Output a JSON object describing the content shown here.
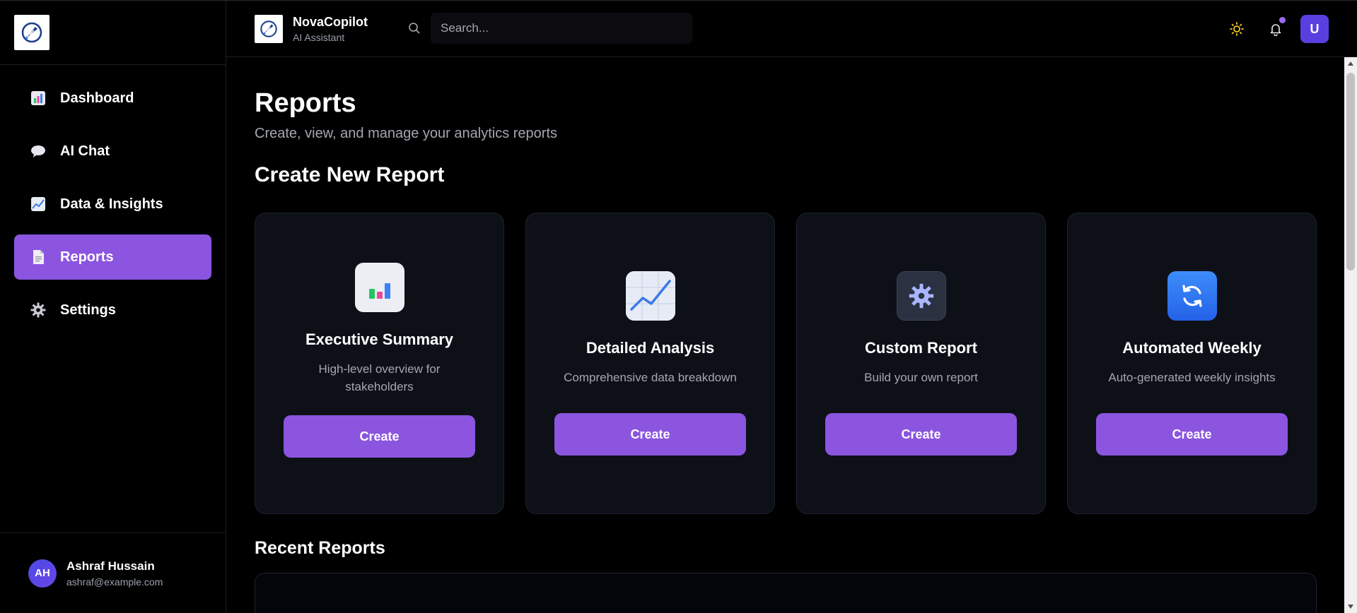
{
  "sidebar": {
    "items": [
      {
        "label": "Dashboard",
        "icon": "bar-chart-icon",
        "active": false
      },
      {
        "label": "AI Chat",
        "icon": "speech-bubble-icon",
        "active": false
      },
      {
        "label": "Data & Insights",
        "icon": "line-chart-icon",
        "active": false
      },
      {
        "label": "Reports",
        "icon": "document-icon",
        "active": true
      },
      {
        "label": "Settings",
        "icon": "gear-icon",
        "active": false
      }
    ],
    "user": {
      "initials": "AH",
      "name": "Ashraf Hussain",
      "email": "ashraf@example.com"
    }
  },
  "header": {
    "brand_name": "NovaCopilot",
    "brand_subtitle": "AI Assistant",
    "search_placeholder": "Search...",
    "user_initial": "U"
  },
  "main": {
    "title": "Reports",
    "subtitle": "Create, view, and manage your analytics reports",
    "create_section_title": "Create New Report",
    "cards": [
      {
        "title": "Executive Summary",
        "description": "High-level overview for stakeholders",
        "button": "Create",
        "icon": "bar-chart-icon"
      },
      {
        "title": "Detailed Analysis",
        "description": "Comprehensive data breakdown",
        "button": "Create",
        "icon": "line-chart-icon"
      },
      {
        "title": "Custom Report",
        "description": "Build your own report",
        "button": "Create",
        "icon": "gear-icon"
      },
      {
        "title": "Automated Weekly",
        "description": "Auto-generated weekly insights",
        "button": "Create",
        "icon": "refresh-icon"
      }
    ],
    "recent_section_title": "Recent Reports"
  },
  "colors": {
    "accent": "#8b55e0",
    "background": "#000000",
    "card_bg": "#0e1018",
    "muted_text": "#a4a7b0",
    "sun_icon": "#f5c518"
  }
}
